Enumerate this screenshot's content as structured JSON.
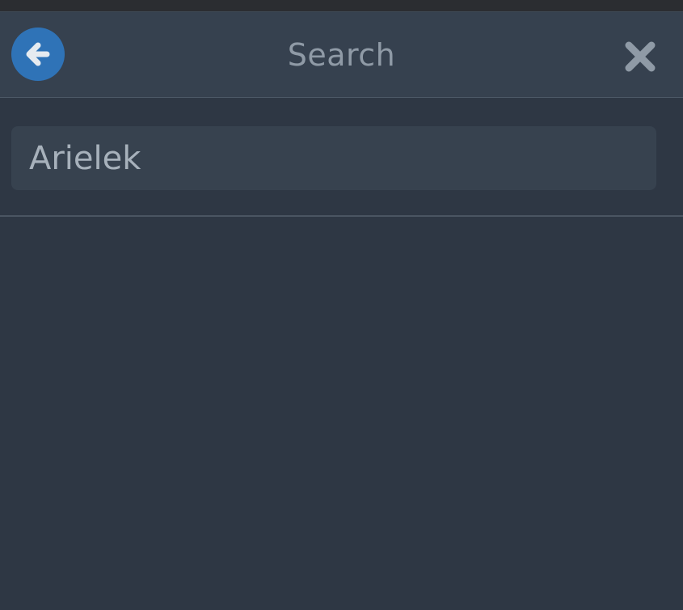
{
  "header": {
    "title": "Search",
    "back_icon": "arrow-left-icon",
    "close_icon": "close-icon",
    "accent_color": "#2f73b7"
  },
  "search": {
    "value": "Arielek",
    "placeholder": ""
  },
  "results": {
    "items": []
  }
}
